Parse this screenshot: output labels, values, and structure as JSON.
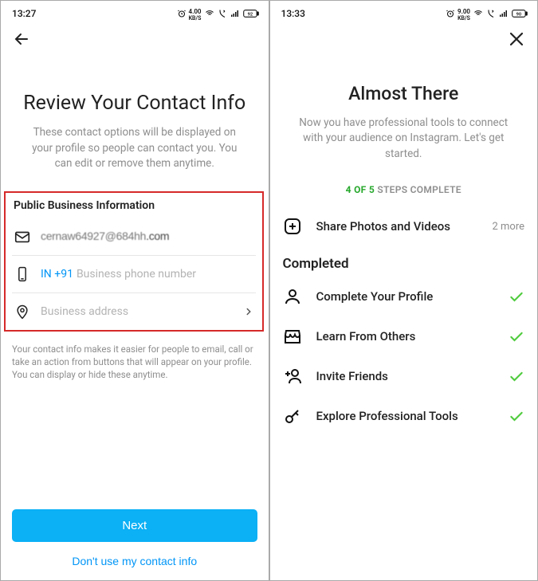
{
  "left": {
    "status": {
      "time": "13:27",
      "kbs_top": "4.00",
      "kbs_bottom": "KB/S"
    },
    "title": "Review Your Contact Info",
    "subtitle": "These contact options will be displayed on your profile so people can contact you. You can edit or remove them anytime.",
    "section_label": "Public Business Information",
    "email": {
      "masked": "cernaw64927@684hh",
      "suffix": ".com"
    },
    "phone": {
      "prefix": "IN +91",
      "placeholder": "Business phone number"
    },
    "address": {
      "placeholder": "Business address"
    },
    "small_desc": "Your contact info makes it easier for people to email, call or take an action from buttons that will appear on your profile. You can display or hide these anytime.",
    "primary_btn": "Next",
    "link_btn": "Don't use my contact info"
  },
  "right": {
    "status": {
      "time": "13:33",
      "kbs_top": "9.00",
      "kbs_bottom": "KB/S"
    },
    "title": "Almost There",
    "subtitle": "Now you have professional tools to connect with your audience on Instagram. Let's get started.",
    "progress": {
      "bold": "4 OF 5",
      "rest": "STEPS COMPLETE"
    },
    "incomplete": {
      "label": "Share Photos and Videos",
      "more": "2 more"
    },
    "completed_label": "Completed",
    "completed": [
      {
        "label": "Complete Your Profile"
      },
      {
        "label": "Learn From Others"
      },
      {
        "label": "Invite Friends"
      },
      {
        "label": "Explore Professional Tools"
      }
    ]
  }
}
